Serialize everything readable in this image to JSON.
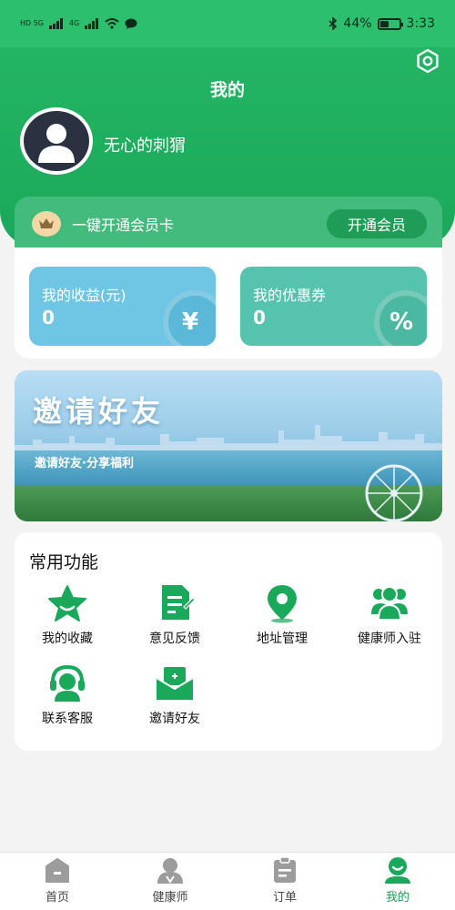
{
  "status_bar": {
    "signal_left": "HD 5G",
    "signal_right": "4G",
    "battery_text": "44%",
    "battery_level": 0.44,
    "time": "3:33"
  },
  "header": {
    "title": "我的",
    "username": "无心的刺猬"
  },
  "member": {
    "text": "一键开通会员卡",
    "button_label": "开通会员"
  },
  "stats": {
    "income_label": "我的收益(元)",
    "income_value": "0",
    "income_symbol": "¥",
    "coupon_label": "我的优惠券",
    "coupon_value": "0",
    "coupon_symbol": "%"
  },
  "banner": {
    "title": "邀请好友",
    "subtitle": "邀请好友·分享福利"
  },
  "functions": {
    "title": "常用功能",
    "items": [
      {
        "label": "我的收藏",
        "icon": "star-icon"
      },
      {
        "label": "意见反馈",
        "icon": "feedback-icon"
      },
      {
        "label": "地址管理",
        "icon": "location-icon"
      },
      {
        "label": "健康师入驻",
        "icon": "team-icon"
      },
      {
        "label": "联系客服",
        "icon": "headset-icon"
      },
      {
        "label": "邀请好友",
        "icon": "invite-icon"
      }
    ]
  },
  "tabs": [
    {
      "label": "首页",
      "icon": "home-icon"
    },
    {
      "label": "健康师",
      "icon": "health-worker-icon"
    },
    {
      "label": "订单",
      "icon": "order-icon"
    },
    {
      "label": "我的",
      "icon": "profile-icon",
      "active": true
    }
  ],
  "colors": {
    "brand_green": "#1aa95a",
    "accent_green": "#1c9f58",
    "income_blue": "#6fc6e4",
    "coupon_teal": "#56c3af"
  }
}
